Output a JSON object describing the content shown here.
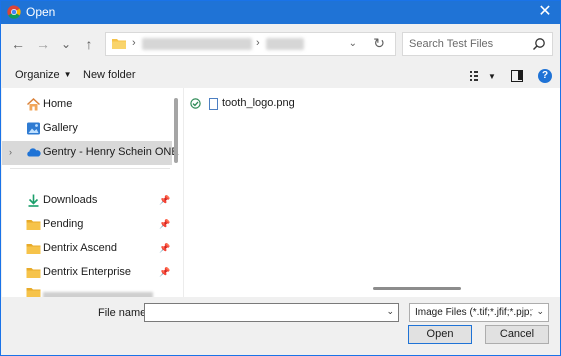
{
  "window": {
    "title": "Open",
    "close_label": "✕"
  },
  "nav_buttons": {
    "back": "←",
    "forward": "→",
    "recent": "⌄",
    "up": "↑"
  },
  "address": {
    "dropdown": "⌄",
    "refresh": "↻"
  },
  "search": {
    "placeholder": "Search Test Files"
  },
  "toolbar": {
    "organize_label": "Organize",
    "new_folder_label": "New folder"
  },
  "sidebar": {
    "items": [
      {
        "label": "Home"
      },
      {
        "label": "Gallery"
      },
      {
        "label": "Gentry - Henry Schein ONE"
      },
      {
        "label": "Downloads"
      },
      {
        "label": "Pending"
      },
      {
        "label": "Dentrix Ascend"
      },
      {
        "label": "Dentrix Enterprise"
      }
    ]
  },
  "files": [
    {
      "name": "tooth_logo.png"
    }
  ],
  "footer": {
    "filename_label": "File name:",
    "filename_value": "",
    "filter_value": "Image Files (*.tif;*.jfif;*.pjp;*.apng",
    "open_label": "Open",
    "cancel_label": "Cancel"
  },
  "colors": {
    "accent": "#1f73d6",
    "folder": "#f6c34a",
    "sync_ok": "#2e8b57"
  }
}
